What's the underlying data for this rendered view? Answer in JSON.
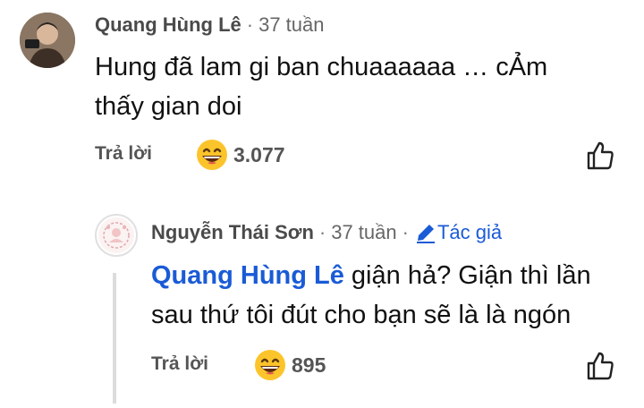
{
  "comment": {
    "author": "Quang Hùng Lê",
    "time": "37 tuần",
    "text_line1": "Hung đã lam gi ban chuaaaaaa … cẢm",
    "text_line2": "thấy gian doi",
    "reply_label": "Trả lời",
    "reaction_count": "3.077"
  },
  "reply": {
    "author": "Nguyễn Thái Sơn",
    "time": "37 tuần",
    "badge": "Tác giả",
    "mention": "Quang Hùng Lê",
    "text_after_mention": " giận hả? Giận thì lần",
    "text_line2": "sau thứ tôi đút cho bạn sẽ là là ngón",
    "reply_label": "Trả lời",
    "reaction_count": "895"
  },
  "icons": {
    "reaction": "grinning-face-emoji",
    "like": "thumbs-up-icon",
    "badge": "pencil-icon",
    "avatar_main": "user-avatar",
    "avatar_reply": "page-avatar"
  },
  "colors": {
    "link": "#1a5bd6",
    "text": "#111111",
    "meta": "#555555",
    "thread_line": "#dcdcdc"
  }
}
